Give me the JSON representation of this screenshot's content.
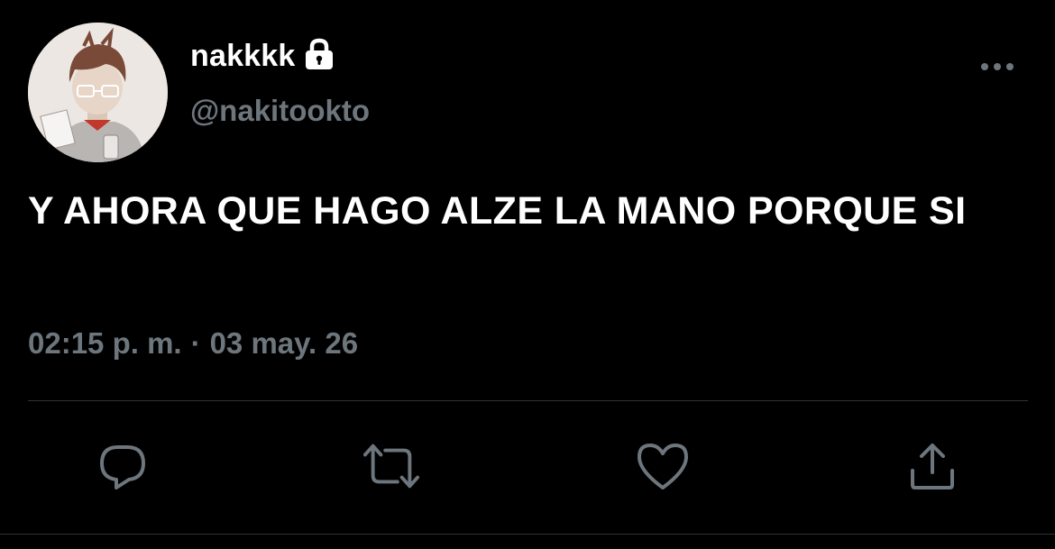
{
  "tweet": {
    "display_name": "nakkkk",
    "handle": "@nakitookto",
    "text": "Y AHORA QUE HAGO ALZE LA MANO PORQUE SI",
    "time": "02:15 p. m.",
    "separator": "·",
    "date": "03 may. 26",
    "icons": {
      "lock": "lock-icon",
      "more": "more-horizontal-icon",
      "reply": "reply-icon",
      "retweet": "retweet-icon",
      "like": "heart-icon",
      "share": "share-icon"
    }
  },
  "colors": {
    "background": "#000000",
    "primary_text": "#ffffff",
    "secondary_text": "#6e767d",
    "divider": "#2f3336",
    "icon": "#6e767d"
  }
}
